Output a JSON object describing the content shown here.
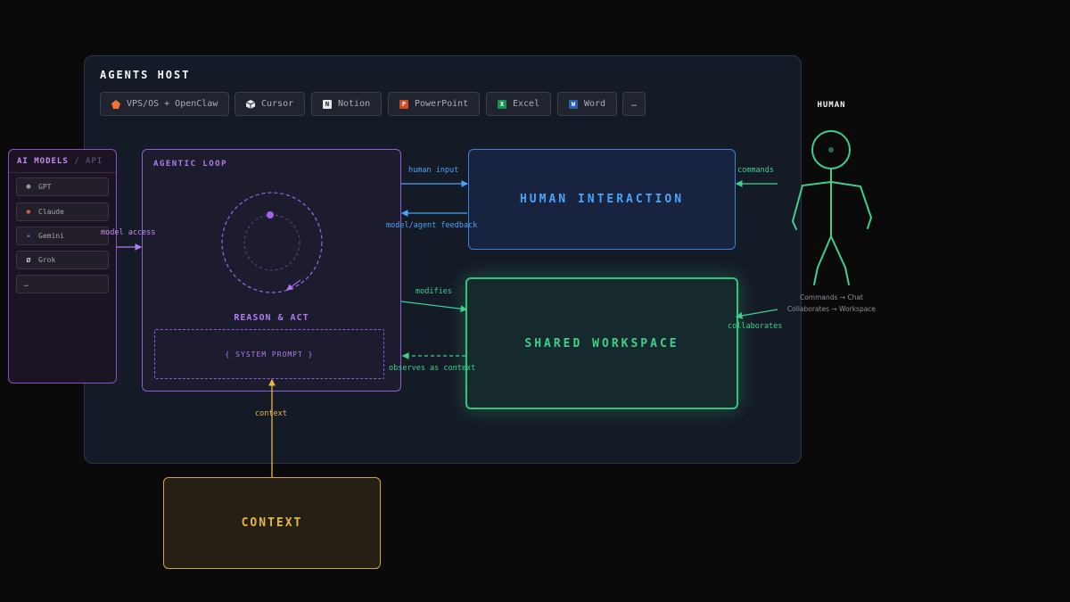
{
  "host": {
    "title": "AGENTS HOST"
  },
  "tools": [
    {
      "label": "VPS/OS + OpenClaw",
      "icon": "openclaw-icon",
      "color": "#f0703a"
    },
    {
      "label": "Cursor",
      "icon": "cursor-icon",
      "color": "#e5e7eb"
    },
    {
      "label": "Notion",
      "icon": "notion-icon",
      "color": "#e5e7eb"
    },
    {
      "label": "PowerPoint",
      "icon": "powerpoint-icon",
      "color": "#d24726"
    },
    {
      "label": "Excel",
      "icon": "excel-icon",
      "color": "#1d8f52"
    },
    {
      "label": "Word",
      "icon": "word-icon",
      "color": "#2b5fb0"
    },
    {
      "label": "…"
    }
  ],
  "models": {
    "title": "AI MODELS",
    "subtitle": "/ API",
    "items": [
      {
        "label": "GPT",
        "icon": "openai-icon"
      },
      {
        "label": "Claude",
        "icon": "claude-icon"
      },
      {
        "label": "Gemini",
        "icon": "gemini-icon"
      },
      {
        "label": "Grok",
        "icon": "grok-icon"
      },
      {
        "label": "…"
      }
    ]
  },
  "loop": {
    "title": "AGENTIC LOOP",
    "reason": "REASON & ACT",
    "system_prompt": "{ SYSTEM PROMPT }"
  },
  "boxes": {
    "human_interaction": "HUMAN INTERACTION",
    "shared_workspace": "SHARED WORKSPACE",
    "context": "CONTEXT"
  },
  "edges": {
    "model_access": "model access",
    "human_input": "human input",
    "feedback": "model/agent feedback",
    "modifies": "modifies",
    "observes": "observes as context",
    "context": "context",
    "commands": "commands",
    "collaborates": "collaborates"
  },
  "human": {
    "title": "HUMAN",
    "caption_1": "Commands → Chat",
    "caption_2": "Collaborates → Workspace"
  },
  "colors": {
    "purple": "#b07cf0",
    "blue": "#4ba3f5",
    "green": "#3ed08a",
    "yellow": "#e8b545"
  }
}
